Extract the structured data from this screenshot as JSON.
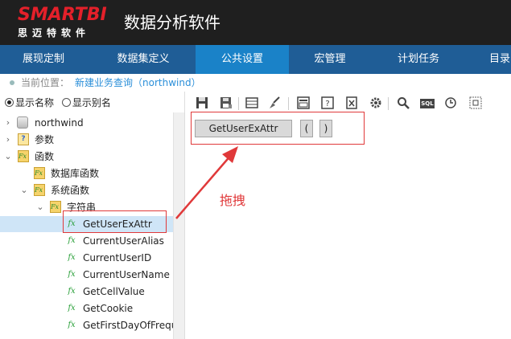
{
  "header": {
    "logo_top": "SMARTBI",
    "logo_bottom": "思迈特软件",
    "app_title": "数据分析软件"
  },
  "nav": {
    "items": [
      {
        "label": "展现定制",
        "active": false
      },
      {
        "label": "数据集定义",
        "active": false
      },
      {
        "label": "公共设置",
        "active": true
      },
      {
        "label": "宏管理",
        "active": false
      },
      {
        "label": "计划任务",
        "active": false
      },
      {
        "label": "目录",
        "active": false
      }
    ]
  },
  "breadcrumb": {
    "label": "当前位置：",
    "path": "新建业务查询（northwind）"
  },
  "left": {
    "radio": [
      {
        "label": "显示名称",
        "checked": true
      },
      {
        "label": "显示别名",
        "checked": false
      }
    ],
    "tree": [
      {
        "label": "northwind",
        "icon": "database-icon",
        "expanded": false
      },
      {
        "label": "参数",
        "icon": "param-folder-icon",
        "expanded": false
      },
      {
        "label": "函数",
        "icon": "function-folder-icon",
        "expanded": true
      },
      {
        "label": "数据库函数",
        "icon": "function-folder-icon"
      },
      {
        "label": "系统函数",
        "icon": "function-folder-icon",
        "expanded": true
      },
      {
        "label": "字符串",
        "icon": "function-folder-icon",
        "expanded": true
      },
      {
        "label": "GetUserExAttr",
        "icon": "fx-icon",
        "selected": true
      },
      {
        "label": "CurrentUserAlias",
        "icon": "fx-icon"
      },
      {
        "label": "CurrentUserID",
        "icon": "fx-icon"
      },
      {
        "label": "CurrentUserName",
        "icon": "fx-icon"
      },
      {
        "label": "GetCellValue",
        "icon": "fx-icon"
      },
      {
        "label": "GetCookie",
        "icon": "fx-icon"
      },
      {
        "label": "GetFirstDayOfFrequ",
        "icon": "fx-icon"
      }
    ]
  },
  "toolbar": {
    "icons": [
      "save-icon",
      "save-as-icon",
      "table-icon",
      "clear-icon",
      "preview-icon",
      "help-icon",
      "excel-icon",
      "settings-icon",
      "search-icon",
      "sql-icon",
      "clock-icon",
      "resize-icon"
    ],
    "sql_text": "SQL"
  },
  "editor": {
    "chips": [
      "GetUserExAttr",
      "(",
      ")"
    ]
  },
  "annotation": {
    "drag_text": "拖拽",
    "color": "#e0393a"
  }
}
